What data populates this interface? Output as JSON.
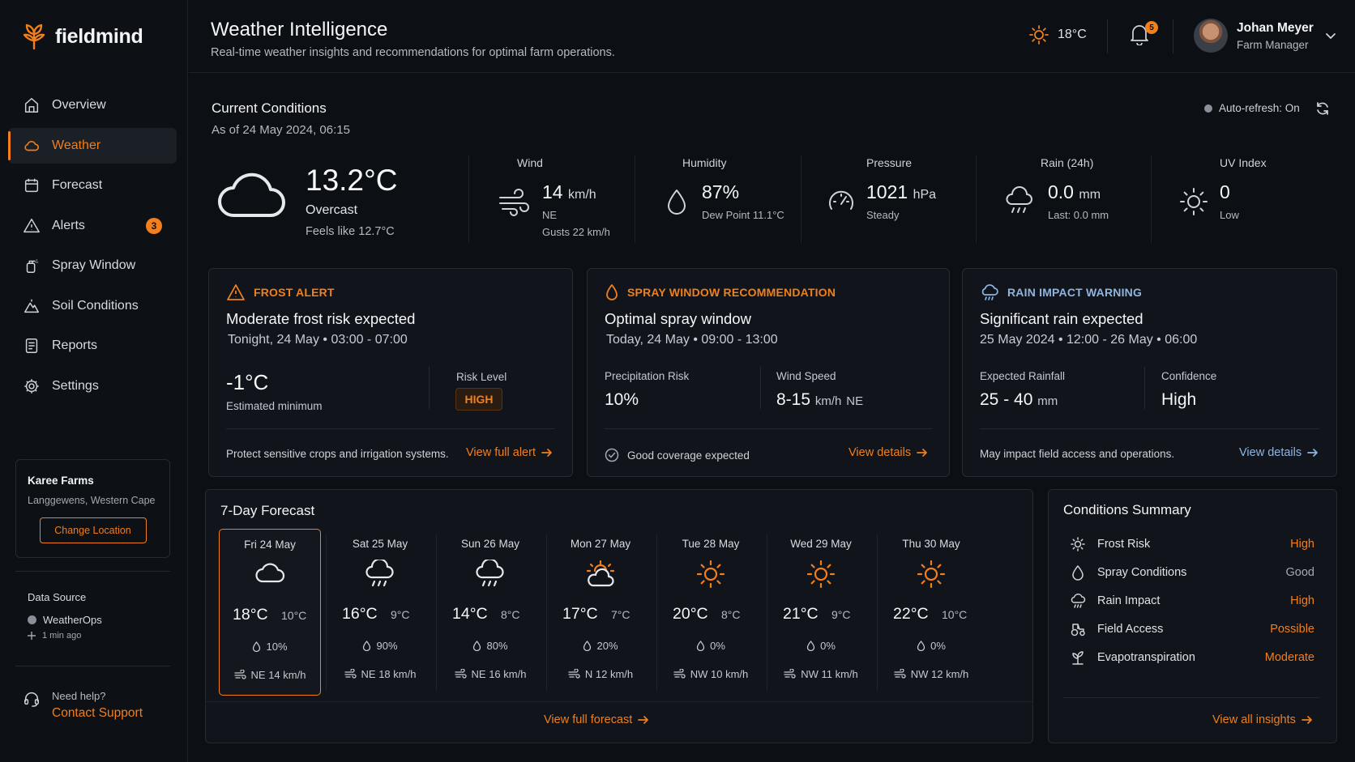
{
  "app": {
    "name": "fieldmind"
  },
  "nav": {
    "items": [
      {
        "label": "Overview"
      },
      {
        "label": "Weather"
      },
      {
        "label": "Forecast"
      },
      {
        "label": "Alerts",
        "badge": "3"
      },
      {
        "label": "Spray Window"
      },
      {
        "label": "Soil Conditions"
      },
      {
        "label": "Reports"
      },
      {
        "label": "Settings"
      }
    ],
    "active": "Weather"
  },
  "farm": {
    "name": "Karee Farms",
    "location": "Langgewens, Western Cape",
    "change_label": "Change Location"
  },
  "data_source": {
    "title": "Data Source",
    "name": "WeatherOps",
    "updated": "1 min ago"
  },
  "help": {
    "label": "Need help?",
    "link": "Contact Support"
  },
  "header": {
    "title": "Weather Intelligence",
    "subtitle": "Real-time weather insights and recommendations for optimal farm operations.",
    "temp": "18°C",
    "notifications": "5",
    "user": {
      "name": "Johan Meyer",
      "role": "Farm Manager"
    }
  },
  "current": {
    "title": "Current Conditions",
    "as_of": "As of 24 May 2024, 06:15",
    "auto_refresh": "Auto-refresh: On",
    "temp": "13.2°C",
    "condition": "Overcast",
    "feels_like": "Feels like 12.7°C",
    "wind": {
      "label": "Wind",
      "value": "14",
      "unit": "km/h",
      "dir": "NE",
      "gusts": "Gusts 22 km/h"
    },
    "humidity": {
      "label": "Humidity",
      "value": "87%",
      "dew": "Dew Point 11.1°C"
    },
    "pressure": {
      "label": "Pressure",
      "value": "1021",
      "unit": "hPa",
      "trend": "Steady"
    },
    "rain": {
      "label": "Rain (24h)",
      "value": "0.0",
      "unit": "mm",
      "last": "Last: 0.0 mm"
    },
    "uv": {
      "label": "UV Index",
      "value": "0",
      "level": "Low"
    }
  },
  "alerts": {
    "frost": {
      "tag": "FROST ALERT",
      "headline": "Moderate frost risk expected",
      "time": "Tonight, 24 May • 03:00 - 07:00",
      "min_temp": "-1°C",
      "min_label": "Estimated minimum",
      "risk_label": "Risk Level",
      "risk_value": "HIGH",
      "footer": "Protect sensitive crops and irrigation systems.",
      "link": "View full alert"
    },
    "spray": {
      "tag": "SPRAY WINDOW RECOMMENDATION",
      "headline": "Optimal spray window",
      "time": "Today, 24 May • 09:00 - 13:00",
      "precip_label": "Precipitation Risk",
      "precip_value": "10%",
      "wind_label": "Wind Speed",
      "wind_value": "8-15",
      "wind_unit": "km/h",
      "wind_dir": "NE",
      "footer": "Good coverage expected",
      "link": "View details"
    },
    "rain": {
      "tag": "RAIN IMPACT WARNING",
      "headline": "Significant rain expected",
      "time": "25 May 2024 • 12:00 - 26 May • 06:00",
      "rainfall_label": "Expected Rainfall",
      "rainfall_value": "25 - 40",
      "rainfall_unit": "mm",
      "confidence_label": "Confidence",
      "confidence_value": "High",
      "footer": "May impact field access and operations.",
      "link": "View details"
    }
  },
  "forecast": {
    "title": "7-Day Forecast",
    "link": "View full forecast",
    "days": [
      {
        "name": "Fri 24 May",
        "icon": "cloud-icon",
        "hi": "18°C",
        "lo": "10°C",
        "precip": "10%",
        "wind": "NE 14 km/h"
      },
      {
        "name": "Sat 25 May",
        "icon": "rain-cloud-icon",
        "hi": "16°C",
        "lo": "9°C",
        "precip": "90%",
        "wind": "NE 18 km/h"
      },
      {
        "name": "Sun 26 May",
        "icon": "rain-cloud-icon",
        "hi": "14°C",
        "lo": "8°C",
        "precip": "80%",
        "wind": "NE 16 km/h"
      },
      {
        "name": "Mon 27 May",
        "icon": "partly-cloudy-icon",
        "hi": "17°C",
        "lo": "7°C",
        "precip": "20%",
        "wind": "N 12 km/h"
      },
      {
        "name": "Tue 28 May",
        "icon": "sun-icon",
        "hi": "20°C",
        "lo": "8°C",
        "precip": "0%",
        "wind": "NW 10 km/h"
      },
      {
        "name": "Wed 29 May",
        "icon": "sun-icon",
        "hi": "21°C",
        "lo": "9°C",
        "precip": "0%",
        "wind": "NW 11 km/h"
      },
      {
        "name": "Thu 30 May",
        "icon": "sun-icon",
        "hi": "22°C",
        "lo": "10°C",
        "precip": "0%",
        "wind": "NW 12 km/h"
      }
    ]
  },
  "summary": {
    "title": "Conditions Summary",
    "link": "View all insights",
    "rows": [
      {
        "label": "Frost Risk",
        "value": "High"
      },
      {
        "label": "Spray Conditions",
        "value": "Good"
      },
      {
        "label": "Rain Impact",
        "value": "High"
      },
      {
        "label": "Field Access",
        "value": "Possible"
      },
      {
        "label": "Evapotranspiration",
        "value": "Moderate"
      }
    ]
  },
  "colors": {
    "accent": "#f07f1c",
    "info": "#8fb4e0",
    "background": "#0c0f14",
    "card": "#11151b"
  }
}
